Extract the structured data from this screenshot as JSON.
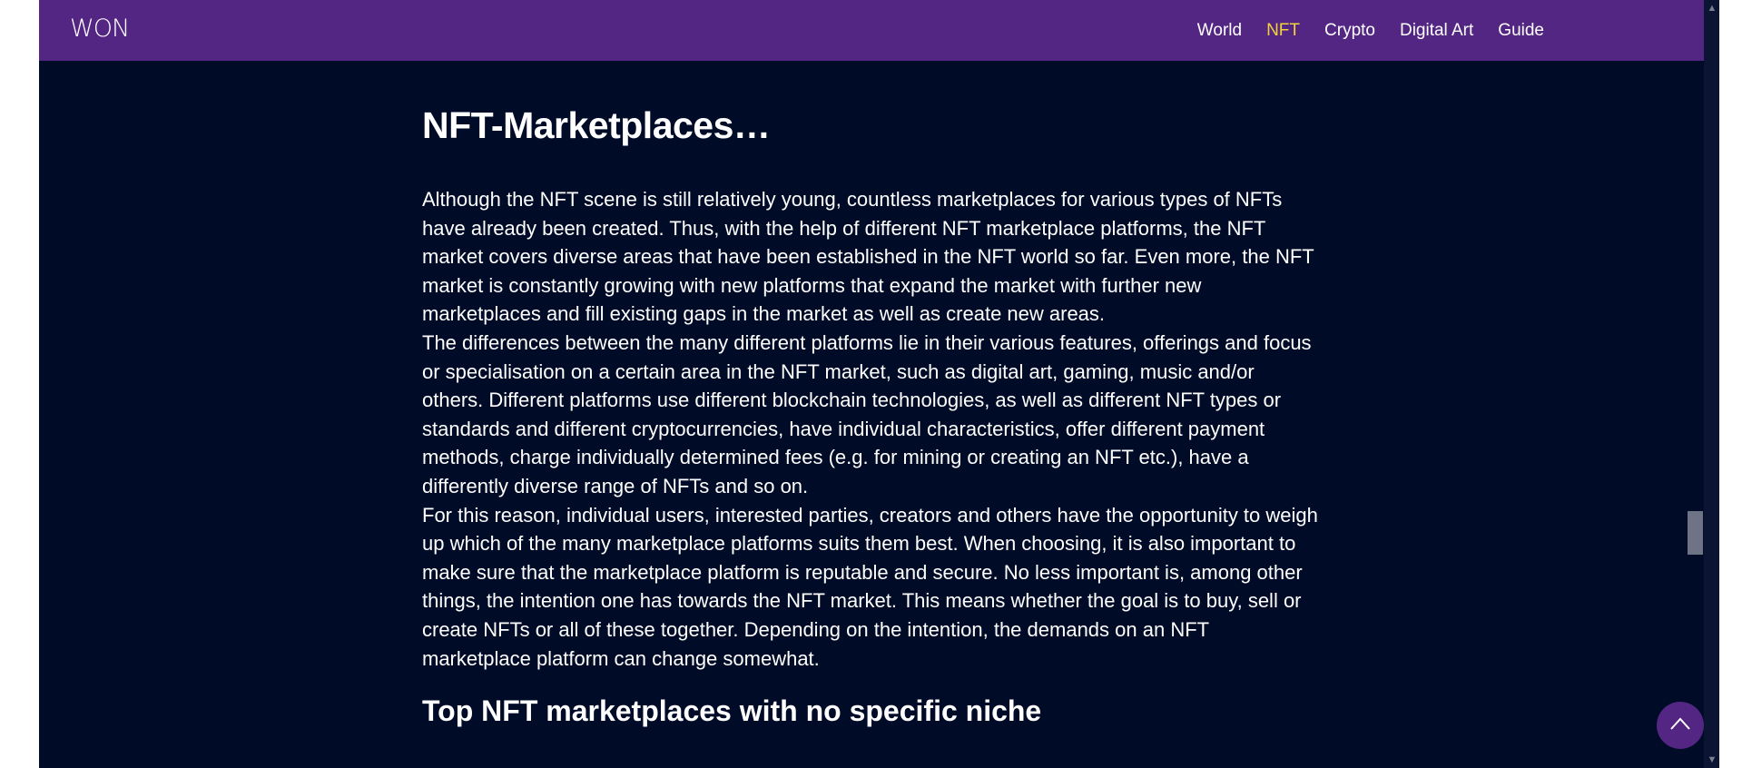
{
  "header": {
    "logo_text": "WON",
    "nav": [
      {
        "label": "World",
        "active": false
      },
      {
        "label": "NFT",
        "active": true
      },
      {
        "label": "Crypto",
        "active": false
      },
      {
        "label": "Digital Art",
        "active": false
      },
      {
        "label": "Guide",
        "active": false
      }
    ]
  },
  "article": {
    "title": "NFT-Marketplaces…",
    "paragraphs": [
      "Although the NFT scene is still relatively young, countless marketplaces for various types of NFTs have already been created. Thus, with the help of different NFT marketplace platforms, the NFT market covers diverse areas that have been established in the NFT world so far. Even more, the NFT market is constantly growing with new platforms that expand the market with further new marketplaces and fill existing gaps in the market as well as create new areas.",
      "The differences between the many different platforms lie in their various features, offerings and focus or specialisation on a certain area in the NFT market, such as digital art, gaming, music and/or others. Different platforms use different blockchain technologies, as well as different NFT types or standards and different cryptocurrencies, have individual characteristics, offer different payment methods, charge individually determined fees (e.g. for mining or creating an NFT etc.), have a differently diverse range of NFTs and so on.",
      "For this reason, individual users, interested parties, creators and others have the opportunity to weigh up which of the many marketplace platforms suits them best. When choosing, it is also important to make sure that the marketplace platform is reputable and secure. No less important is, among other things, the intention one has towards the NFT market. This means whether the goal is to buy, sell or create NFTs or all of these together. Depending on the intention, the demands on an NFT marketplace platform can change somewhat."
    ],
    "next_heading": "Top NFT marketplaces with no specific niche"
  },
  "colors": {
    "header_bg": "#532683",
    "page_bg": "#000b28",
    "nav_active": "#f2d23b",
    "text": "#ffffff"
  },
  "icons": {
    "back_to_top": "chevron-up-icon",
    "scroll_up": "triangle-up-icon",
    "scroll_down": "triangle-down-icon"
  },
  "scroll": {
    "position_fraction": 0.72
  }
}
